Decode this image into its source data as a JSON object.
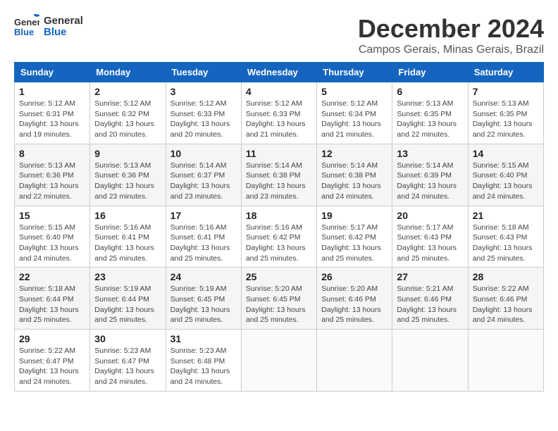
{
  "brand": {
    "name_part1": "General",
    "name_part2": "Blue"
  },
  "header": {
    "month_year": "December 2024",
    "location": "Campos Gerais, Minas Gerais, Brazil"
  },
  "days_of_week": [
    "Sunday",
    "Monday",
    "Tuesday",
    "Wednesday",
    "Thursday",
    "Friday",
    "Saturday"
  ],
  "weeks": [
    [
      {
        "day": "1",
        "sunrise": "Sunrise: 5:12 AM",
        "sunset": "Sunset: 6:31 PM",
        "daylight": "Daylight: 13 hours and 19 minutes."
      },
      {
        "day": "2",
        "sunrise": "Sunrise: 5:12 AM",
        "sunset": "Sunset: 6:32 PM",
        "daylight": "Daylight: 13 hours and 20 minutes."
      },
      {
        "day": "3",
        "sunrise": "Sunrise: 5:12 AM",
        "sunset": "Sunset: 6:33 PM",
        "daylight": "Daylight: 13 hours and 20 minutes."
      },
      {
        "day": "4",
        "sunrise": "Sunrise: 5:12 AM",
        "sunset": "Sunset: 6:33 PM",
        "daylight": "Daylight: 13 hours and 21 minutes."
      },
      {
        "day": "5",
        "sunrise": "Sunrise: 5:12 AM",
        "sunset": "Sunset: 6:34 PM",
        "daylight": "Daylight: 13 hours and 21 minutes."
      },
      {
        "day": "6",
        "sunrise": "Sunrise: 5:13 AM",
        "sunset": "Sunset: 6:35 PM",
        "daylight": "Daylight: 13 hours and 22 minutes."
      },
      {
        "day": "7",
        "sunrise": "Sunrise: 5:13 AM",
        "sunset": "Sunset: 6:35 PM",
        "daylight": "Daylight: 13 hours and 22 minutes."
      }
    ],
    [
      {
        "day": "8",
        "sunrise": "Sunrise: 5:13 AM",
        "sunset": "Sunset: 6:36 PM",
        "daylight": "Daylight: 13 hours and 22 minutes."
      },
      {
        "day": "9",
        "sunrise": "Sunrise: 5:13 AM",
        "sunset": "Sunset: 6:36 PM",
        "daylight": "Daylight: 13 hours and 23 minutes."
      },
      {
        "day": "10",
        "sunrise": "Sunrise: 5:14 AM",
        "sunset": "Sunset: 6:37 PM",
        "daylight": "Daylight: 13 hours and 23 minutes."
      },
      {
        "day": "11",
        "sunrise": "Sunrise: 5:14 AM",
        "sunset": "Sunset: 6:38 PM",
        "daylight": "Daylight: 13 hours and 23 minutes."
      },
      {
        "day": "12",
        "sunrise": "Sunrise: 5:14 AM",
        "sunset": "Sunset: 6:38 PM",
        "daylight": "Daylight: 13 hours and 24 minutes."
      },
      {
        "day": "13",
        "sunrise": "Sunrise: 5:14 AM",
        "sunset": "Sunset: 6:39 PM",
        "daylight": "Daylight: 13 hours and 24 minutes."
      },
      {
        "day": "14",
        "sunrise": "Sunrise: 5:15 AM",
        "sunset": "Sunset: 6:40 PM",
        "daylight": "Daylight: 13 hours and 24 minutes."
      }
    ],
    [
      {
        "day": "15",
        "sunrise": "Sunrise: 5:15 AM",
        "sunset": "Sunset: 6:40 PM",
        "daylight": "Daylight: 13 hours and 24 minutes."
      },
      {
        "day": "16",
        "sunrise": "Sunrise: 5:16 AM",
        "sunset": "Sunset: 6:41 PM",
        "daylight": "Daylight: 13 hours and 25 minutes."
      },
      {
        "day": "17",
        "sunrise": "Sunrise: 5:16 AM",
        "sunset": "Sunset: 6:41 PM",
        "daylight": "Daylight: 13 hours and 25 minutes."
      },
      {
        "day": "18",
        "sunrise": "Sunrise: 5:16 AM",
        "sunset": "Sunset: 6:42 PM",
        "daylight": "Daylight: 13 hours and 25 minutes."
      },
      {
        "day": "19",
        "sunrise": "Sunrise: 5:17 AM",
        "sunset": "Sunset: 6:42 PM",
        "daylight": "Daylight: 13 hours and 25 minutes."
      },
      {
        "day": "20",
        "sunrise": "Sunrise: 5:17 AM",
        "sunset": "Sunset: 6:43 PM",
        "daylight": "Daylight: 13 hours and 25 minutes."
      },
      {
        "day": "21",
        "sunrise": "Sunrise: 5:18 AM",
        "sunset": "Sunset: 6:43 PM",
        "daylight": "Daylight: 13 hours and 25 minutes."
      }
    ],
    [
      {
        "day": "22",
        "sunrise": "Sunrise: 5:18 AM",
        "sunset": "Sunset: 6:44 PM",
        "daylight": "Daylight: 13 hours and 25 minutes."
      },
      {
        "day": "23",
        "sunrise": "Sunrise: 5:19 AM",
        "sunset": "Sunset: 6:44 PM",
        "daylight": "Daylight: 13 hours and 25 minutes."
      },
      {
        "day": "24",
        "sunrise": "Sunrise: 5:19 AM",
        "sunset": "Sunset: 6:45 PM",
        "daylight": "Daylight: 13 hours and 25 minutes."
      },
      {
        "day": "25",
        "sunrise": "Sunrise: 5:20 AM",
        "sunset": "Sunset: 6:45 PM",
        "daylight": "Daylight: 13 hours and 25 minutes."
      },
      {
        "day": "26",
        "sunrise": "Sunrise: 5:20 AM",
        "sunset": "Sunset: 6:46 PM",
        "daylight": "Daylight: 13 hours and 25 minutes."
      },
      {
        "day": "27",
        "sunrise": "Sunrise: 5:21 AM",
        "sunset": "Sunset: 6:46 PM",
        "daylight": "Daylight: 13 hours and 25 minutes."
      },
      {
        "day": "28",
        "sunrise": "Sunrise: 5:22 AM",
        "sunset": "Sunset: 6:46 PM",
        "daylight": "Daylight: 13 hours and 24 minutes."
      }
    ],
    [
      {
        "day": "29",
        "sunrise": "Sunrise: 5:22 AM",
        "sunset": "Sunset: 6:47 PM",
        "daylight": "Daylight: 13 hours and 24 minutes."
      },
      {
        "day": "30",
        "sunrise": "Sunrise: 5:23 AM",
        "sunset": "Sunset: 6:47 PM",
        "daylight": "Daylight: 13 hours and 24 minutes."
      },
      {
        "day": "31",
        "sunrise": "Sunrise: 5:23 AM",
        "sunset": "Sunset: 6:48 PM",
        "daylight": "Daylight: 13 hours and 24 minutes."
      },
      null,
      null,
      null,
      null
    ]
  ]
}
